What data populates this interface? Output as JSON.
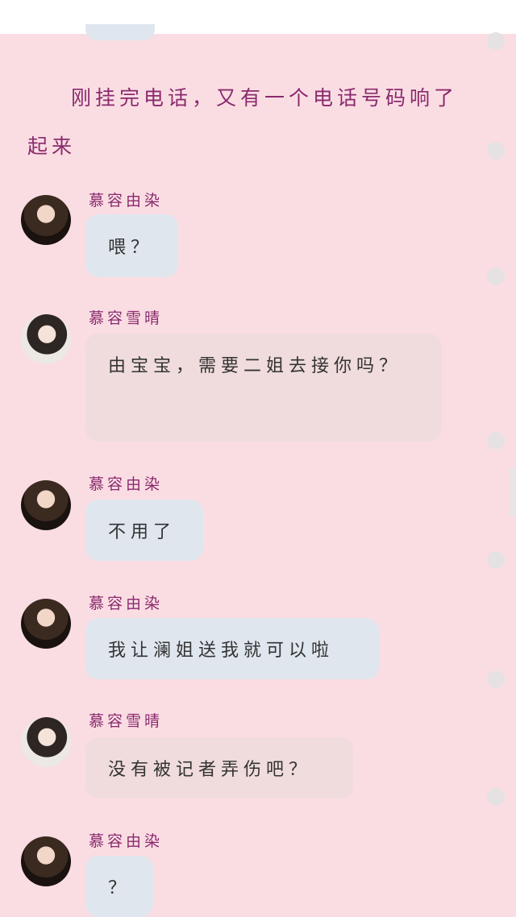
{
  "narration": "刚挂完电话，又有一个电话号码响了起来",
  "messages": [
    {
      "sender": "慕容由染",
      "text": "喂？",
      "avatar_icon": "avatar-ran"
    },
    {
      "sender": "慕容雪晴",
      "text": "由宝宝，需要二姐去接你吗？",
      "avatar_icon": "avatar-qing"
    },
    {
      "sender": "慕容由染",
      "text": "不用了",
      "avatar_icon": "avatar-ran"
    },
    {
      "sender": "慕容由染",
      "text": "我让澜姐送我就可以啦",
      "avatar_icon": "avatar-ran"
    },
    {
      "sender": "慕容雪晴",
      "text": "没有被记者弄伤吧？",
      "avatar_icon": "avatar-qing"
    },
    {
      "sender": "慕容由染",
      "text": "？",
      "avatar_icon": "avatar-ran"
    }
  ],
  "colors": {
    "background": "#fadde3",
    "name_color": "#8a2a6e",
    "bubble_ran": "#dfe6ee",
    "bubble_qing": "#f0dcdc"
  }
}
